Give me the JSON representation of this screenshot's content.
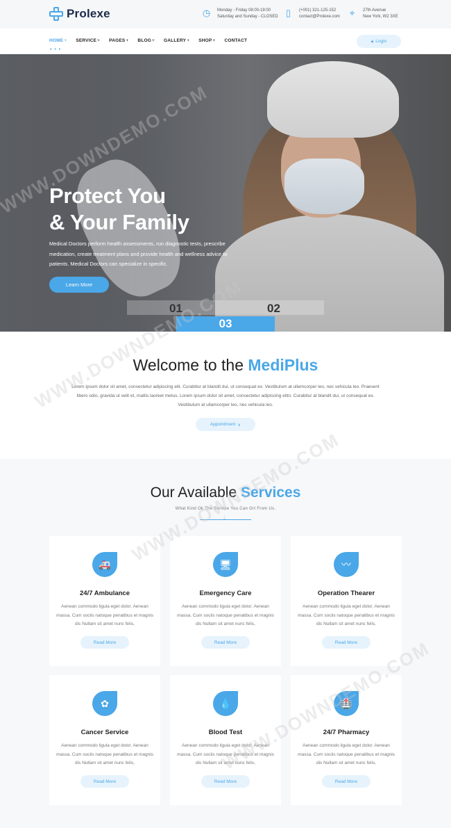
{
  "brand": {
    "name": "Prolexe",
    "accent": "#4aa7e8",
    "dark": "#1b2a4a"
  },
  "topbar": {
    "hours": {
      "icon": "clock-icon",
      "line1": "Monday - Friday 08:00-19:00",
      "line2": "Saturday and Sunday - CLOSED"
    },
    "contact": {
      "icon": "phone-icon",
      "line1": "(+001) 321-125-152",
      "line2": "contact@Prolexe.com"
    },
    "address": {
      "icon": "location-icon",
      "line1": "27th Avenue",
      "line2": "New York, W2 3XE"
    }
  },
  "nav": {
    "items": [
      {
        "label": "HOME",
        "plus": "+",
        "active": true
      },
      {
        "label": "SERVICE",
        "plus": "+"
      },
      {
        "label": "PAGES",
        "plus": "+"
      },
      {
        "label": "BLOG",
        "plus": "+"
      },
      {
        "label": "GALLERY",
        "plus": "+"
      },
      {
        "label": "SHOP",
        "plus": "+"
      },
      {
        "label": "CONTACT",
        "plus": ""
      }
    ],
    "dots": "• • •",
    "login": "Login"
  },
  "hero": {
    "title_line1": "Protect You",
    "title_line2": "& Your Family",
    "description": "Medical Doctors perform health assessments, run diagnostic tests, prescribe medication, create treatment plans and provide health and wellness advice to patients. Medical Doctors can specialize in specific.",
    "button": "Learn More",
    "slides": [
      "01",
      "02",
      "03"
    ]
  },
  "welcome": {
    "title_prefix": "Welcome to the ",
    "title_highlight": "MediPlus",
    "text": "Lorem ipsum dolor sit amet, consectetur adipiscing elit. Curabitur at blandit dui, ut consequat ex. Vestibulum at ullamcorper leo, nec vehicula leo. Praesent libero odio, gravida ut velit et, mattis laoreet metus. Lorem ipsum dolor sit amet, consectetur adipiscing elitn. Curabitur at blandit dui, ut consequat ex. Vestibulum at ullamcorper leo, nec vehicula leo.",
    "button": "Appointment",
    "button_chevron": "∨"
  },
  "services": {
    "title_prefix": "Our Available ",
    "title_highlight": "Services",
    "subtitle": "What Kind Ok The Service You Can Grt From Us.",
    "cards": [
      {
        "title": "24/7 Ambulance",
        "icon": "ambulance-icon",
        "glyph": "🚑",
        "text": "Aenean commodo ligula eget dolor. Aenean massa. Cum sociis natoque penatibus et magnis dis Nullam sit amet nunc felis,",
        "button": "Read More"
      },
      {
        "title": "Emergency Care",
        "icon": "monitor-icon",
        "glyph": "🖥",
        "text": "Aenean commodo ligula eget dolor. Aenean massa. Cum sociis natoque penatibus et magnis dis Nullam sit amet nunc felis,",
        "button": "Read More"
      },
      {
        "title": "Operation Thearer",
        "icon": "heartbeat-icon",
        "glyph": "〰",
        "text": "Aenean commodo ligula eget dolor. Aenean massa. Cum sociis natoque penatibus et magnis dis Nullam sit amet nunc felis,",
        "button": "Read More"
      },
      {
        "title": "Cancer Service",
        "icon": "brain-icon",
        "glyph": "✿",
        "text": "Aenean commodo ligula eget dolor. Aenean massa. Cum sociis natoque penatibus et magnis dis Nullam sit amet nunc felis,",
        "button": "Read More"
      },
      {
        "title": "Blood Test",
        "icon": "blood-drop-icon",
        "glyph": "💧",
        "text": "Aenean commodo ligula eget dolor. Aenean massa. Cum sociis natoque penatibus et magnis dis Nullam sit amet nunc felis,",
        "button": "Read More"
      },
      {
        "title": "24/7 Pharmacy",
        "icon": "pharmacy-building-icon",
        "glyph": "🏥",
        "text": "Aenean commodo ligula eget dolor. Aenean massa. Cum sociis natoque penatibus et magnis dis Nullam sit amet nunc felis,",
        "button": "Read More"
      }
    ]
  },
  "watermark": "WWW.DOWNDEMO.COM"
}
